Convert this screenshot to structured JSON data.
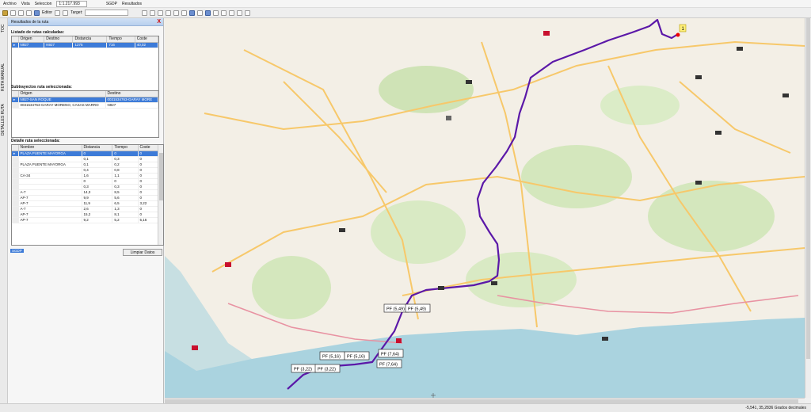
{
  "menu": {
    "archivo": "Archivo",
    "vista": "Vista",
    "seleccion": "Seleccion",
    "scale": "1:1.217.993",
    "sgdp": "SGDP",
    "resultados": "Resultados"
  },
  "toolbar": {
    "editor": "Editor",
    "target": "Target:"
  },
  "side_tabs": {
    "toc": "TOC",
    "ruta_manual": "RUTA MANUAL",
    "detalles_ruta": "DETALLES RUTA"
  },
  "panel": {
    "title": "Resultados de la ruta",
    "close": "X",
    "routes_heading": "Listado de rutas calculadas:",
    "routes_columns": [
      "Origen",
      "Destino",
      "Distancia",
      "Tiempo",
      "Coste"
    ],
    "routes_rows": [
      [
        "N927",
        "N927",
        "1275",
        "716",
        "40,02"
      ]
    ],
    "subroutes_heading": "Subtrayectos ruta seleccionada:",
    "subroutes_columns": [
      "Origen",
      "Destino"
    ],
    "subroutes_rows": [
      [
        "N927-SAN ROQUE",
        "0031534763-GARAY MORE"
      ],
      [
        "0031534763-GARAY MORENO, CASAS MARRO",
        "N927"
      ]
    ],
    "detail_heading": "Detalle ruta seleccionada:",
    "detail_columns": [
      "Nombre",
      "Distancia",
      "Tiempo",
      "Coste"
    ],
    "detail_rows": [
      [
        "PLAZA PUENTE MAYORGA",
        "0",
        "0",
        "0"
      ],
      [
        "",
        "0,1",
        "0,3",
        "0"
      ],
      [
        "PLAZA PUENTE MAYORGA",
        "0,1",
        "0,2",
        "0"
      ],
      [
        "",
        "0,4",
        "0,8",
        "0"
      ],
      [
        "CA-34",
        "1,6",
        "1,1",
        "0"
      ],
      [
        "",
        "0",
        "0",
        "0"
      ],
      [
        "",
        "0,3",
        "0,3",
        "0"
      ],
      [
        "A-7",
        "14,3",
        "8,5",
        "0"
      ],
      [
        "AP-7",
        "9,9",
        "5,6",
        "0"
      ],
      [
        "AP-7",
        "11,9",
        "6,5",
        "3,22"
      ],
      [
        "A-7",
        "2,6",
        "1,3",
        "0"
      ],
      [
        "AP-7",
        "15,2",
        "8,1",
        "0"
      ],
      [
        "AP-7",
        "9,2",
        "5,2",
        "5,16"
      ]
    ],
    "legend": "SGDP",
    "clear_button": "Limpiar Datos"
  },
  "map": {
    "route_color": "#5b18a8",
    "pf_labels": [
      "PF (5,49)",
      "PF (5,49)",
      "PF (5,16)",
      "PF (5,16)",
      "PF (7,64)",
      "PF (7,64)",
      "PF (3,22)",
      "PF (3,22)"
    ],
    "marker_label": "1"
  },
  "status": {
    "coords": "-5,541, 35,2836  Grados decimales"
  }
}
